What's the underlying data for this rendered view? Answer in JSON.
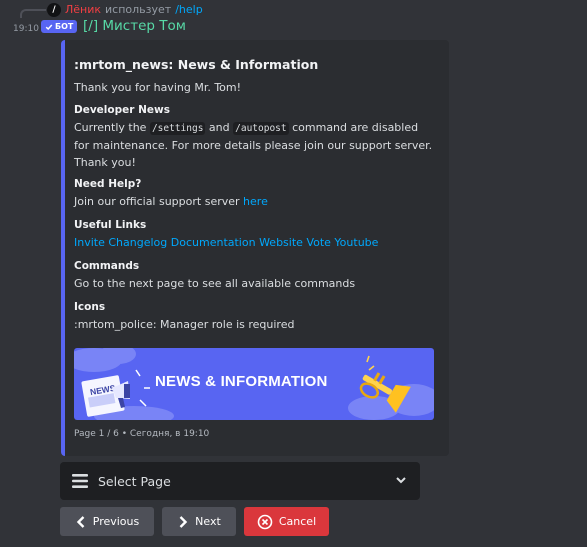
{
  "reply": {
    "user": "Лёник",
    "uses": "использует",
    "command": "/help",
    "badge": "/"
  },
  "message": {
    "time": "19:10",
    "bot_tag": "БОТ",
    "author": "[/] Мистер Том"
  },
  "embed": {
    "title": ":mrtom_news: News & Information",
    "description": "Thank you for having Mr. Tom!",
    "developer_news": {
      "name": "Developer News",
      "text_1": "Currently the",
      "code_1": "/settings",
      "text_2": "and",
      "code_2": "/autopost",
      "text_3": "command are disabled for maintenance. For more details please join our support server. Thank you!"
    },
    "need_help": {
      "name": "Need Help?",
      "text": "Join our official support server",
      "link": "here"
    },
    "useful_links": {
      "name": "Useful Links",
      "links": [
        "Invite",
        "Changelog",
        "Documentation",
        "Website",
        "Vote",
        "Youtube"
      ]
    },
    "commands": {
      "name": "Commands",
      "text": "Go to the next page to see all available commands"
    },
    "icons": {
      "name": "Icons",
      "text": ":mrtom_police: Manager role is required"
    },
    "banner_text": "NEWS & INFORMATION",
    "banner_sign": "NEWS",
    "footer": "Page 1 / 6 • Сегодня, в 19:10"
  },
  "components": {
    "select_placeholder": "Select Page",
    "previous": "Previous",
    "next": "Next",
    "cancel": "Cancel"
  },
  "colors": {
    "background": "#313338",
    "embed_bg": "#2b2d31",
    "accent": "#5865f2",
    "link": "#00a8fc",
    "author": "#57d9a6",
    "danger": "#da373c",
    "secondary_button": "#4e5058"
  }
}
